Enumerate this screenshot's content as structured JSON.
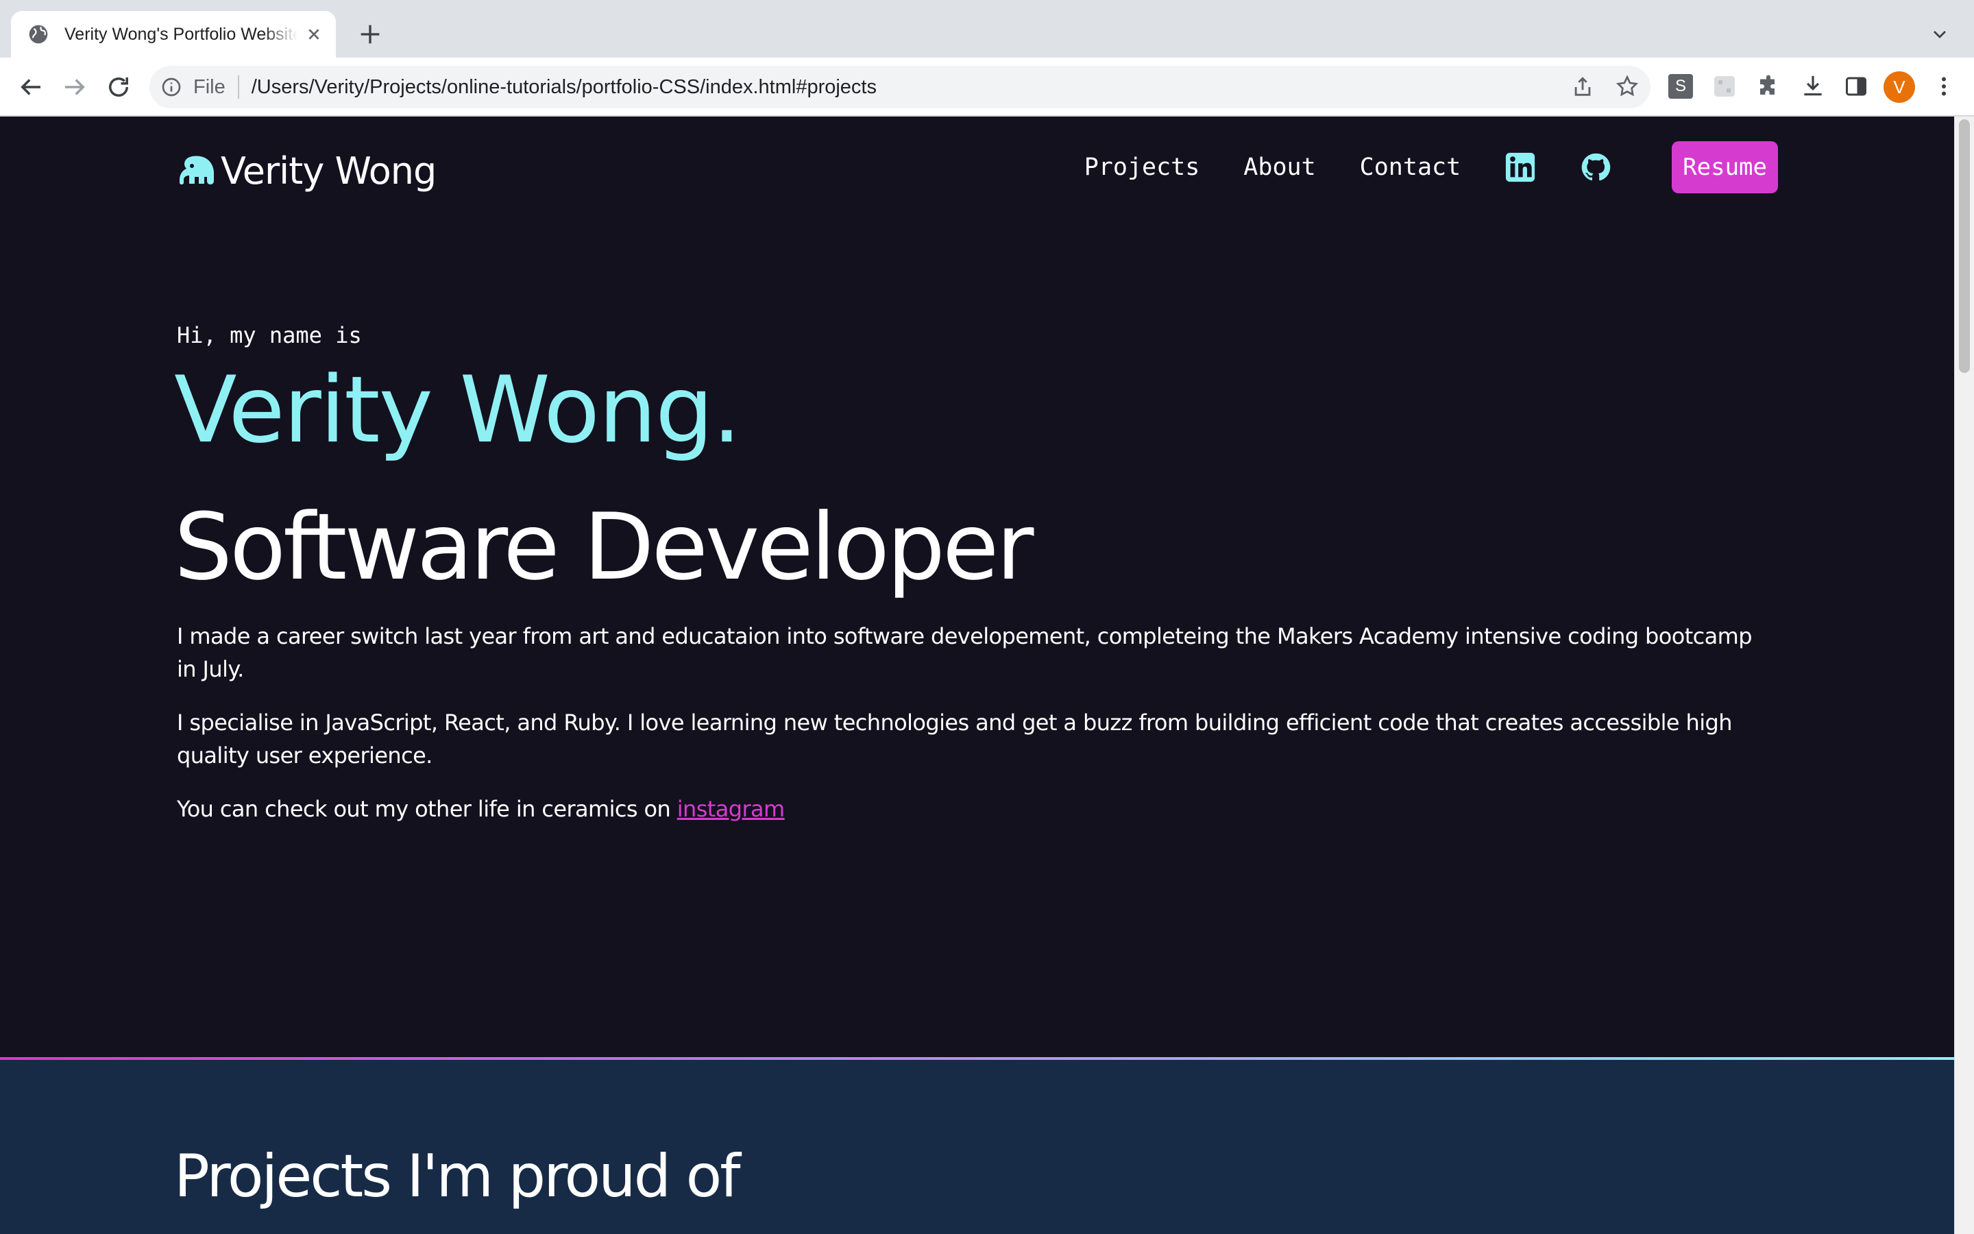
{
  "browser": {
    "tab_title": "Verity Wong's Portfolio Website",
    "url_scheme": "File",
    "url": "/Users/Verity/Projects/online-tutorials/portfolio-CSS/index.html#projects",
    "profile_initial": "V",
    "extension_s_label": "S"
  },
  "site": {
    "logo_text": "Verity Wong",
    "nav": {
      "projects": "Projects",
      "about": "About",
      "contact": "Contact",
      "resume": "Resume"
    },
    "hero": {
      "greeting": "Hi, my name is",
      "name": "Verity Wong.",
      "role": "Software Developer",
      "bio_1": "I made a career switch last year from art and educataion into software developement, completeing the Makers Academy intensive coding bootcamp in July.",
      "bio_2": "I specialise in JavaScript, React, and Ruby. I love learning new technologies and get a buzz from building efficient code that creates accessible high quality user experience.",
      "bio_3_prefix": "You can check out my other life in ceramics on ",
      "bio_3_link": "instagram"
    },
    "projects_heading": "Projects I'm proud of"
  },
  "colors": {
    "page_bg": "#13111e",
    "accent_cyan": "#8ff0f4",
    "accent_magenta": "#d63bcf",
    "projects_bg": "#172b47"
  }
}
